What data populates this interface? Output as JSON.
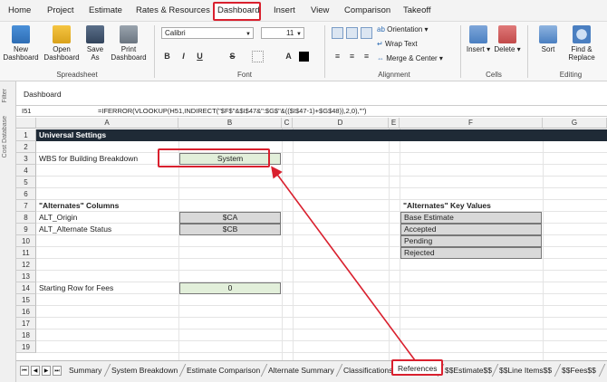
{
  "menubar": {
    "items": [
      "Home",
      "Project",
      "Estimate",
      "Rates & Resources",
      "Dashboard",
      "Insert",
      "View",
      "Comparison",
      "Takeoff"
    ]
  },
  "ribbon": {
    "spreadsheet": {
      "new": "New Dashboard",
      "open": "Open Dashboard",
      "save": "Save As",
      "print": "Print Dashboard",
      "group": "Spreadsheet"
    },
    "font": {
      "name": "Calibri",
      "size": "11",
      "group": "Font"
    },
    "alignment": {
      "orientation": "Orientation",
      "wrap": "Wrap Text",
      "merge": "Merge & Center",
      "group": "Alignment"
    },
    "cells": {
      "insert": "Insert",
      "delete": "Delete",
      "group": "Cells"
    },
    "editing": {
      "sort": "Sort",
      "find": "Find & Replace",
      "group": "Editing"
    }
  },
  "sidebar": {
    "filter": "Filter",
    "cost_db": "Cost Database"
  },
  "dashboard_label": "Dashboard",
  "formula_bar": {
    "cell_ref": "I51",
    "formula": "=IFERROR(VLOOKUP(H51,INDIRECT(\"$F$\"&$I$47&\":$G$\"&(($I$47-1)+$G$48)),2,0),\"\")"
  },
  "columns": [
    "A",
    "B",
    "C",
    "D",
    "E",
    "F",
    "G"
  ],
  "rows": [
    "1",
    "2",
    "3",
    "4",
    "5",
    "6",
    "7",
    "8",
    "9",
    "10",
    "11",
    "12",
    "13",
    "14",
    "15",
    "16",
    "17",
    "18",
    "19"
  ],
  "sheet": {
    "title": "Universal Settings",
    "wbs_label": "WBS for Building Breakdown",
    "wbs_value": "System",
    "alternates_columns_label": "\"Alternates\" Columns",
    "alt_origin_label": "ALT_Origin",
    "alt_origin_value": "$CA",
    "alt_status_label": "ALT_Alternate Status",
    "alt_status_value": "$CB",
    "key_values_label": "\"Alternates\" Key Values",
    "key_values": [
      "Base Estimate",
      "Accepted",
      "Pending",
      "Rejected"
    ],
    "fees_label": "Starting Row for Fees",
    "fees_value": "0"
  },
  "tabs": [
    "Summary",
    "System Breakdown",
    "Estimate Comparison",
    "Alternate Summary",
    "Classifications",
    "References",
    "$$Estimate$$",
    "$$Line Items$$",
    "$$Fees$$"
  ],
  "active_tab": "References",
  "colors": {
    "highlight": "#d9202e",
    "title_bar": "#1f2a36",
    "gray_cell": "#d9d9d9",
    "green_cell": "#e2efda"
  }
}
